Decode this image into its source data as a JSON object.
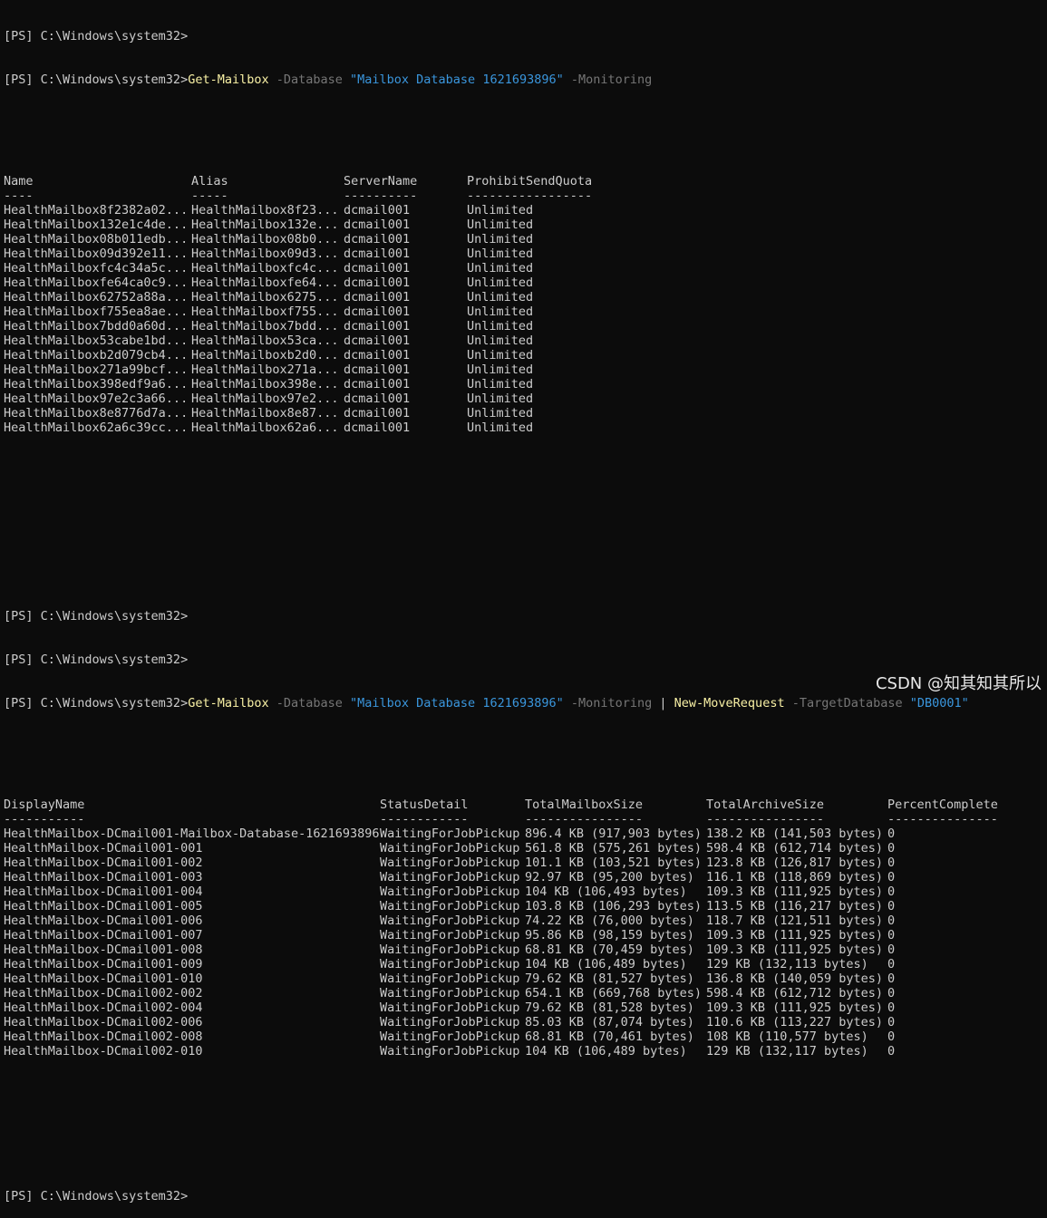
{
  "prompt1": "[PS] C:\\Windows\\system32>",
  "cmd1": {
    "prompt": "[PS] C:\\Windows\\system32>",
    "verb": "Get-Mailbox",
    "p1": " -Database ",
    "s1": "\"Mailbox Database 1621693896\"",
    "p2": " -Monitoring"
  },
  "table1": {
    "headers": [
      "Name",
      "Alias",
      "ServerName",
      "ProhibitSendQuota"
    ],
    "underlines": [
      "----",
      "-----",
      "----------",
      "-----------------"
    ],
    "rows": [
      [
        "HealthMailbox8f2382a02...",
        "HealthMailbox8f23...",
        "dcmail001",
        "Unlimited"
      ],
      [
        "HealthMailbox132e1c4de...",
        "HealthMailbox132e...",
        "dcmail001",
        "Unlimited"
      ],
      [
        "HealthMailbox08b011edb...",
        "HealthMailbox08b0...",
        "dcmail001",
        "Unlimited"
      ],
      [
        "HealthMailbox09d392e11...",
        "HealthMailbox09d3...",
        "dcmail001",
        "Unlimited"
      ],
      [
        "HealthMailboxfc4c34a5c...",
        "HealthMailboxfc4c...",
        "dcmail001",
        "Unlimited"
      ],
      [
        "HealthMailboxfe64ca0c9...",
        "HealthMailboxfe64...",
        "dcmail001",
        "Unlimited"
      ],
      [
        "HealthMailbox62752a88a...",
        "HealthMailbox6275...",
        "dcmail001",
        "Unlimited"
      ],
      [
        "HealthMailboxf755ea8ae...",
        "HealthMailboxf755...",
        "dcmail001",
        "Unlimited"
      ],
      [
        "HealthMailbox7bdd0a60d...",
        "HealthMailbox7bdd...",
        "dcmail001",
        "Unlimited"
      ],
      [
        "HealthMailbox53cabe1bd...",
        "HealthMailbox53ca...",
        "dcmail001",
        "Unlimited"
      ],
      [
        "HealthMailboxb2d079cb4...",
        "HealthMailboxb2d0...",
        "dcmail001",
        "Unlimited"
      ],
      [
        "HealthMailbox271a99bcf...",
        "HealthMailbox271a...",
        "dcmail001",
        "Unlimited"
      ],
      [
        "HealthMailbox398edf9a6...",
        "HealthMailbox398e...",
        "dcmail001",
        "Unlimited"
      ],
      [
        "HealthMailbox97e2c3a66...",
        "HealthMailbox97e2...",
        "dcmail001",
        "Unlimited"
      ],
      [
        "HealthMailbox8e8776d7a...",
        "HealthMailbox8e87...",
        "dcmail001",
        "Unlimited"
      ],
      [
        "HealthMailbox62a6c39cc...",
        "HealthMailbox62a6...",
        "dcmail001",
        "Unlimited"
      ]
    ]
  },
  "prompt2": "[PS] C:\\Windows\\system32>",
  "prompt3": "[PS] C:\\Windows\\system32>",
  "cmd2": {
    "prompt": "[PS] C:\\Windows\\system32>",
    "verb": "Get-Mailbox",
    "p1": " -Database ",
    "s1": "\"Mailbox Database 1621693896\"",
    "p2": " -Monitoring ",
    "pipe": "| ",
    "verb2": "New-MoveRequest",
    "p3": " -TargetDatabase ",
    "s2": "\"DB0001\""
  },
  "table2": {
    "headers": [
      "DisplayName",
      "StatusDetail",
      "TotalMailboxSize",
      "TotalArchiveSize",
      "PercentComplete"
    ],
    "underlines": [
      "-----------",
      "------------",
      "----------------",
      "----------------",
      "---------------"
    ],
    "rows": [
      [
        "HealthMailbox-DCmail001-Mailbox-Database-1621693896",
        "WaitingForJobPickup",
        "896.4 KB (917,903 bytes)",
        "138.2 KB (141,503 bytes)",
        "0"
      ],
      [
        "HealthMailbox-DCmail001-001",
        "WaitingForJobPickup",
        "561.8 KB (575,261 bytes)",
        "598.4 KB (612,714 bytes)",
        "0"
      ],
      [
        "HealthMailbox-DCmail001-002",
        "WaitingForJobPickup",
        "101.1 KB (103,521 bytes)",
        "123.8 KB (126,817 bytes)",
        "0"
      ],
      [
        "HealthMailbox-DCmail001-003",
        "WaitingForJobPickup",
        "92.97 KB (95,200 bytes)",
        "116.1 KB (118,869 bytes)",
        "0"
      ],
      [
        "HealthMailbox-DCmail001-004",
        "WaitingForJobPickup",
        "104 KB (106,493 bytes)",
        "109.3 KB (111,925 bytes)",
        "0"
      ],
      [
        "HealthMailbox-DCmail001-005",
        "WaitingForJobPickup",
        "103.8 KB (106,293 bytes)",
        "113.5 KB (116,217 bytes)",
        "0"
      ],
      [
        "HealthMailbox-DCmail001-006",
        "WaitingForJobPickup",
        "74.22 KB (76,000 bytes)",
        "118.7 KB (121,511 bytes)",
        "0"
      ],
      [
        "HealthMailbox-DCmail001-007",
        "WaitingForJobPickup",
        "95.86 KB (98,159 bytes)",
        "109.3 KB (111,925 bytes)",
        "0"
      ],
      [
        "HealthMailbox-DCmail001-008",
        "WaitingForJobPickup",
        "68.81 KB (70,459 bytes)",
        "109.3 KB (111,925 bytes)",
        "0"
      ],
      [
        "HealthMailbox-DCmail001-009",
        "WaitingForJobPickup",
        "104 KB (106,489 bytes)",
        "129 KB (132,113 bytes)",
        "0"
      ],
      [
        "HealthMailbox-DCmail001-010",
        "WaitingForJobPickup",
        "79.62 KB (81,527 bytes)",
        "136.8 KB (140,059 bytes)",
        "0"
      ],
      [
        "HealthMailbox-DCmail002-002",
        "WaitingForJobPickup",
        "654.1 KB (669,768 bytes)",
        "598.4 KB (612,712 bytes)",
        "0"
      ],
      [
        "HealthMailbox-DCmail002-004",
        "WaitingForJobPickup",
        "79.62 KB (81,528 bytes)",
        "109.3 KB (111,925 bytes)",
        "0"
      ],
      [
        "HealthMailbox-DCmail002-006",
        "WaitingForJobPickup",
        "85.03 KB (87,074 bytes)",
        "110.6 KB (113,227 bytes)",
        "0"
      ],
      [
        "HealthMailbox-DCmail002-008",
        "WaitingForJobPickup",
        "68.81 KB (70,461 bytes)",
        "108 KB (110,577 bytes)",
        "0"
      ],
      [
        "HealthMailbox-DCmail002-010",
        "WaitingForJobPickup",
        "104 KB (106,489 bytes)",
        "129 KB (132,117 bytes)",
        "0"
      ]
    ]
  },
  "prompt4": "[PS] C:\\Windows\\system32>",
  "watermark": "CSDN @知其知其所以",
  "colors": {
    "background": "#0c0c0c",
    "text": "#cccccc",
    "command": "#f9f1a5",
    "parameter": "#767676",
    "string": "#3a96dd"
  }
}
